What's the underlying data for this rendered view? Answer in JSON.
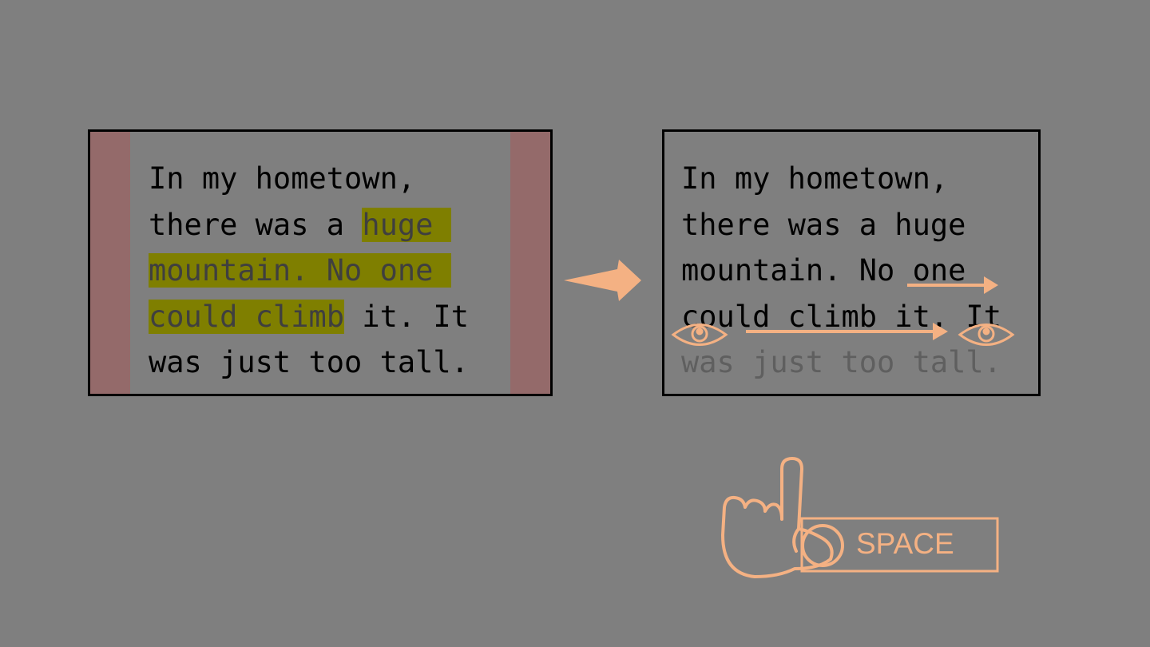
{
  "left_panel": {
    "line1": "In my hometown,",
    "line2_pre": "there was a ",
    "line2_hl": "huge ",
    "line3_hl": "mountain. No one ",
    "line4_hl": "could climb",
    "line4_post": " it. It",
    "line5": "was just too tall."
  },
  "right_panel": {
    "line1": "In my hometown,",
    "line2": "there was a huge",
    "line3": "mountain. No one",
    "line4": "could climb it. It",
    "line5": "was just too tall."
  },
  "space_key": {
    "label": "SPACE"
  },
  "colors": {
    "background": "#7f7f7f",
    "margin_band": "#946a6a",
    "highlight": "#7f7f00",
    "accent": "#f4b183"
  },
  "icons": [
    "arrow-right-icon",
    "eye-icon",
    "pointing-hand-icon"
  ]
}
